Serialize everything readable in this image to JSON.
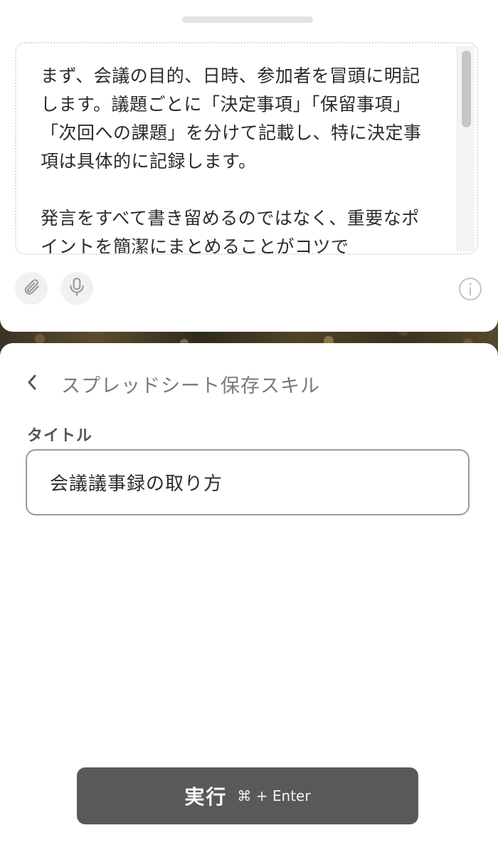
{
  "editor": {
    "content": "まず、会議の目的、日時、参加者を冒頭に明記します。議題ごとに「決定事項」「保留事項」「次回への課題」を分けて記載し、特に決定事項は具体的に記録します。\n\n発言をすべて書き留めるのではなく、重要なポイントを簡潔にまとめることがコツで",
    "icons": [
      "paperclip-icon",
      "microphone-icon",
      "info-icon"
    ]
  },
  "skill_panel": {
    "title": "スプレッドシート保存スキル",
    "field_label": "タイトル",
    "title_value": "会議議事録の取り方"
  },
  "run_button": {
    "label": "実行",
    "shortcut": "⌘ + Enter"
  }
}
